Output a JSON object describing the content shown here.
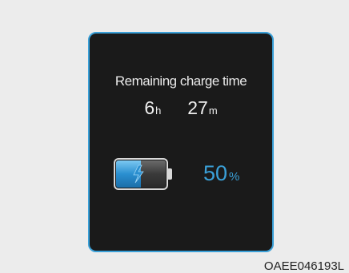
{
  "display": {
    "title": "Remaining charge time",
    "hours_value": "6",
    "hours_unit": "h",
    "minutes_value": "27",
    "minutes_unit": "m",
    "battery_percent_value": "50",
    "battery_percent_unit": "%",
    "battery_level": 0.5,
    "battery_icon": "battery-charging-icon",
    "accent_color": "#3aa0d8",
    "background_color": "#1a1a1a"
  },
  "caption": {
    "code": "OAEE046193L"
  }
}
